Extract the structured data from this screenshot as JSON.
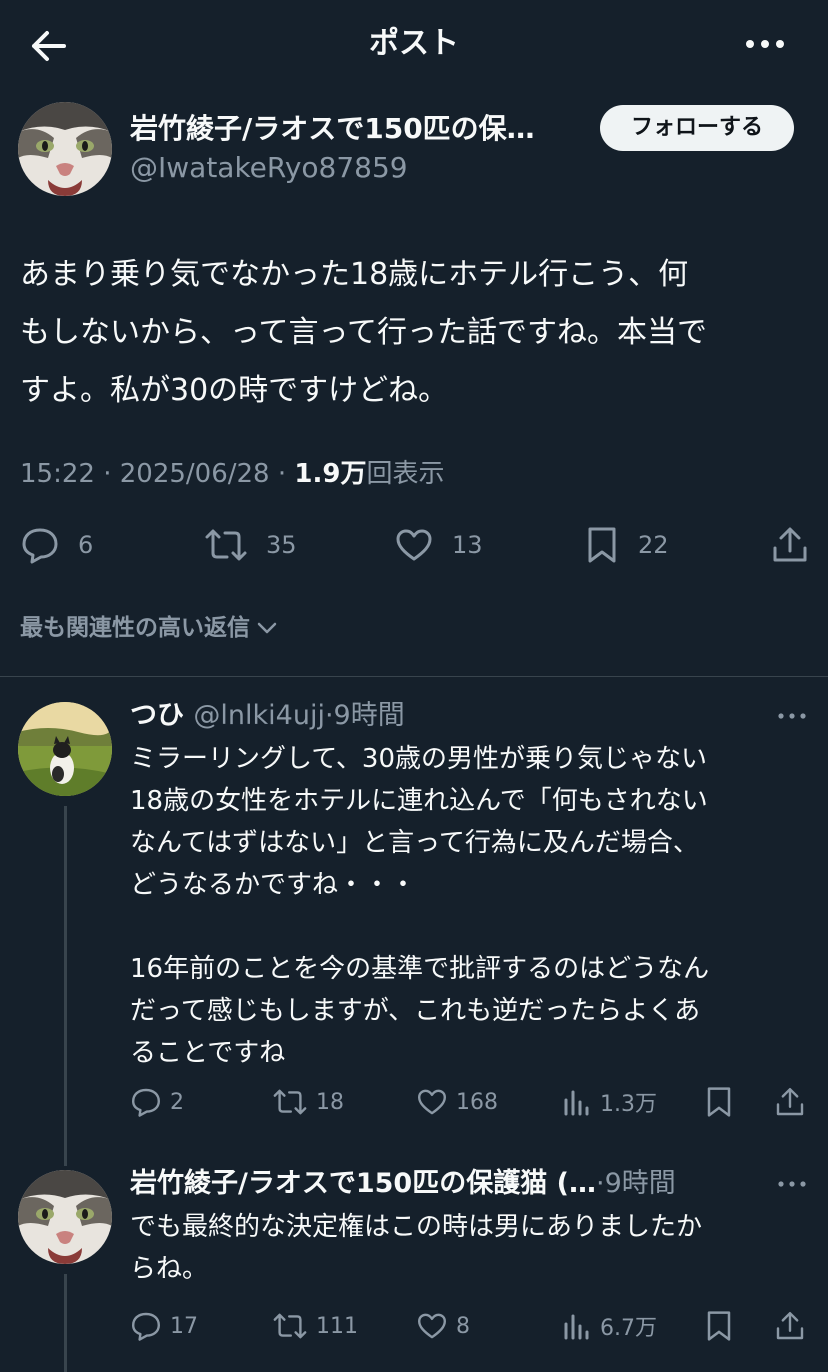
{
  "header": {
    "title": "ポスト",
    "icons": {
      "back": "arrow-left-icon",
      "more": "more-horizontal-icon"
    }
  },
  "post": {
    "author_name": "岩竹綾子/ラオスで150匹の保…",
    "author_handle": "@IwatakeRyo87859",
    "follow_label": "フォローする",
    "text_lines": [
      "あまり乗り気でなかった18歳にホテル行こう、何",
      "もしないから、って言って行った話ですね。本当で",
      "すよ。私が30の時ですけどね。"
    ],
    "time": "15:22",
    "dot": "·",
    "date": "2025/06/28",
    "views_count": "1.9万",
    "views_label": "回表示",
    "stats": {
      "replies": "6",
      "reposts": "35",
      "likes": "13",
      "bookmarks": "22"
    },
    "icons": {
      "reply": "reply-icon",
      "repost": "repost-icon",
      "like": "heart-icon",
      "bookmark": "bookmark-icon",
      "share": "share-icon"
    }
  },
  "relevant_label": "最も関連性の高い返信",
  "replies": [
    {
      "name": "つひ",
      "handle": "@lnlki4ujj",
      "time": "9時間",
      "dot": "·",
      "text_lines": [
        "ミラーリングして、30歳の男性が乗り気じゃない",
        "18歳の女性をホテルに連れ込んで「何もされない",
        "なんてはずはない」と言って行為に及んだ場合、",
        "どうなるかですね・・・",
        "",
        "16年前のことを今の基準で批評するのはどうなん",
        "だって感じもしますが、これも逆だったらよくあ",
        "ることですね"
      ],
      "stats": {
        "replies": "2",
        "reposts": "18",
        "likes": "168",
        "views": "1.3万"
      }
    },
    {
      "name": "岩竹綾子/ラオスで150匹の保護猫 (…",
      "handle": "",
      "time": "9時間",
      "dot": "·",
      "text_lines": [
        "でも最終的な決定権はこの時は男にありましたか",
        "らね。"
      ],
      "stats": {
        "replies": "17",
        "reposts": "111",
        "likes": "8",
        "views": "6.7万"
      }
    }
  ],
  "colors": {
    "background": "#15202b",
    "text": "#f7f9f9",
    "muted": "#8b98a5",
    "divider": "#38444d",
    "follow_bg": "#eff3f4"
  }
}
